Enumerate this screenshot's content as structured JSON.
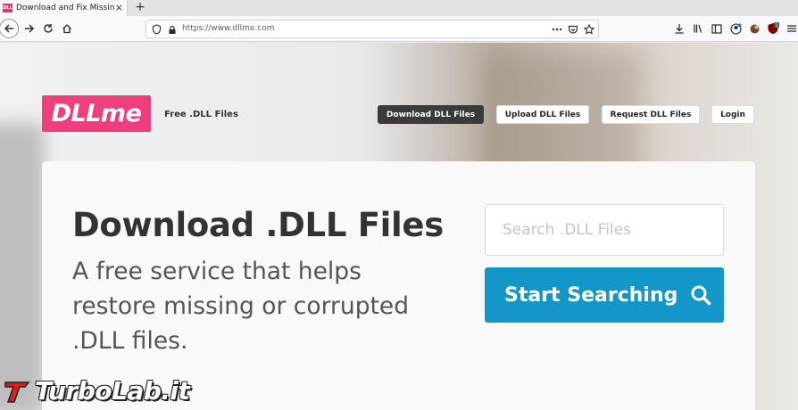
{
  "browser": {
    "tab": {
      "favicon_text": "DLL",
      "title": "Download and Fix Missing .DLL",
      "close_glyph": "×"
    },
    "new_tab_glyph": "+",
    "url": "https://www.dllme.com"
  },
  "header": {
    "logo_text": "DLLme",
    "tagline": "Free .DLL Files",
    "nav": [
      {
        "label": "Download DLL Files"
      },
      {
        "label": "Upload DLL Files"
      },
      {
        "label": "Request DLL Files"
      },
      {
        "label": "Login"
      }
    ]
  },
  "hero": {
    "title": "Download .DLL Files",
    "subtitle": "A free service that helps restore missing or corrupted .DLL files.",
    "search_placeholder": "Search .DLL Files",
    "search_button": "Start Searching"
  },
  "watermark": {
    "text": "TurboLab.it"
  },
  "colors": {
    "brand": "#ef3e7c",
    "accent": "#1497c8",
    "dark_button": "#3a3a3a"
  },
  "icons": [
    "back-arrow-icon",
    "forward-arrow-icon",
    "reload-icon",
    "home-icon",
    "shield-icon",
    "lock-icon",
    "more-icon",
    "pocket-icon",
    "bookmark-star-icon",
    "downloads-icon",
    "library-icon",
    "sidebar-icon",
    "account-icon",
    "extension-icon",
    "ublock-icon",
    "menu-icon",
    "search-icon"
  ]
}
